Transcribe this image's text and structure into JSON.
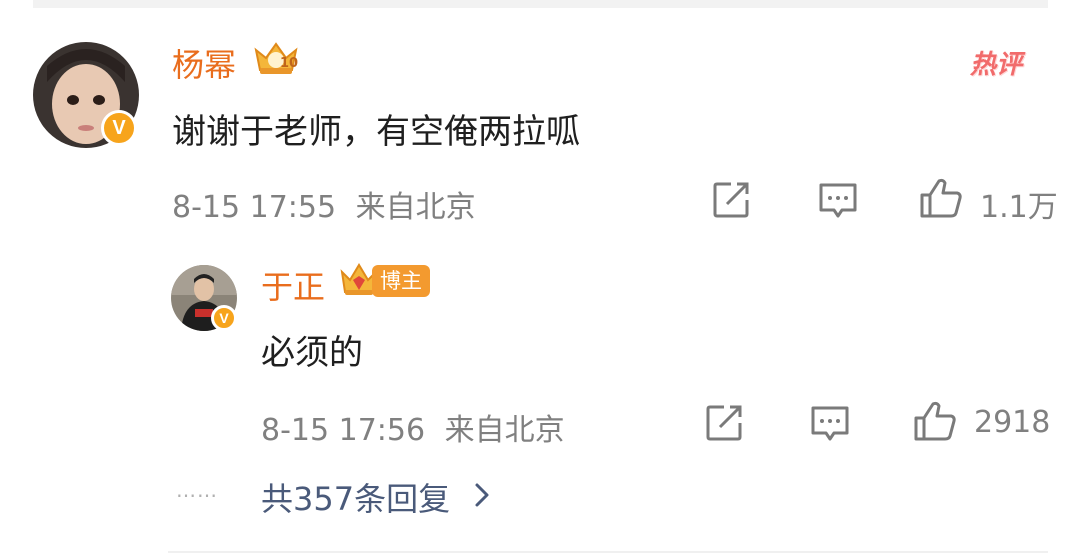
{
  "comment": {
    "author": "杨幂",
    "text": "谢谢于老师，有空俺两拉呱",
    "time": "8-15 17:55",
    "location": "来自北京",
    "likes": "1.1万",
    "hot_label": "热评",
    "level_badge": "10"
  },
  "reply": {
    "author": "于正",
    "badge_label": "博主",
    "text": "必须的",
    "time": "8-15 17:56",
    "location": "来自北京",
    "likes": "2918"
  },
  "more_replies": {
    "dots": "……",
    "label": "共357条回复"
  },
  "colors": {
    "name": "#e96d1d",
    "verified": "#f7a41c",
    "hot": "#f16b6b",
    "link": "#4a5a7a"
  },
  "icons": [
    "share-icon",
    "comment-icon",
    "like-icon",
    "chevron-right-icon",
    "verified-icon",
    "crown-icon"
  ]
}
